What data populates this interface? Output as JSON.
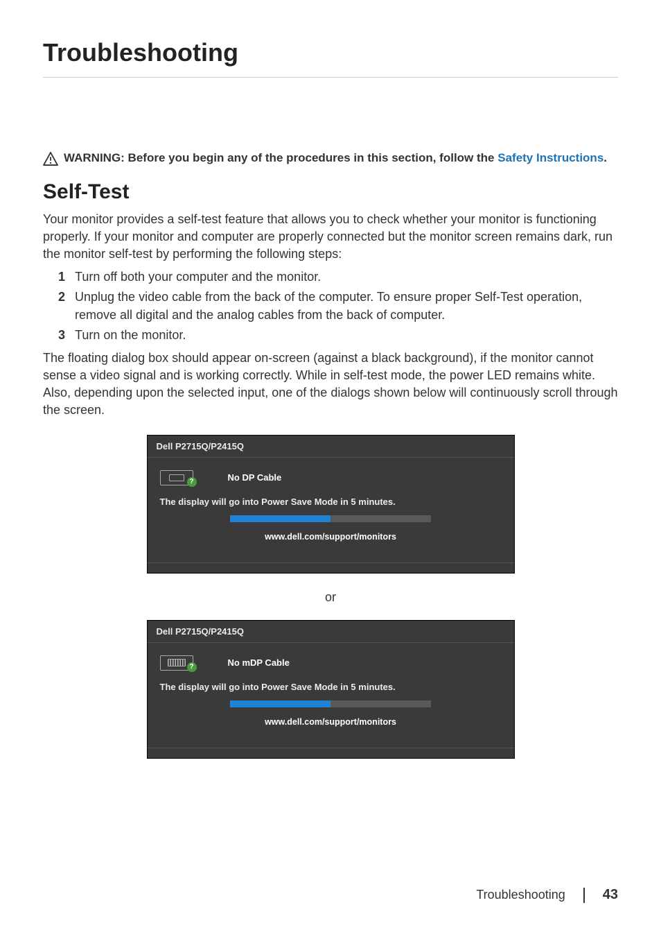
{
  "page": {
    "title": "Troubleshooting",
    "footer_label": "Troubleshooting",
    "page_number": "43"
  },
  "warning": {
    "lead": "WARNING:  Before you begin any of the procedures in this section, follow the ",
    "link_text": "Safety Instructions",
    "tail": "."
  },
  "selftest": {
    "heading": "Self-Test",
    "intro": "Your monitor provides a self-test feature that allows you to check whether your monitor is functioning properly. If your monitor and computer are properly connected but the monitor screen remains dark, run the monitor self-test by performing the following steps:",
    "steps": [
      "Turn off both your computer and the monitor.",
      "Unplug the video cable from the back of the computer. To ensure proper Self-Test operation, remove all digital and the analog cables from the back of computer.",
      "Turn on the monitor."
    ],
    "after": "The floating dialog box should appear on-screen (against a black background), if the monitor cannot sense a video signal and is working correctly. While in self-test mode, the power LED remains white. Also, depending upon the selected input, one of the dialogs shown below will continuously scroll through the screen."
  },
  "dialogs": {
    "model_header": "Dell P2715Q/P2415Q",
    "power_save_msg": "The display will go into Power Save Mode in 5 minutes.",
    "support_url": "www.dell.com/support/monitors",
    "dp": {
      "cable_label": "No DP Cable"
    },
    "mdp": {
      "cable_label": "No mDP Cable"
    },
    "separator": "or"
  }
}
